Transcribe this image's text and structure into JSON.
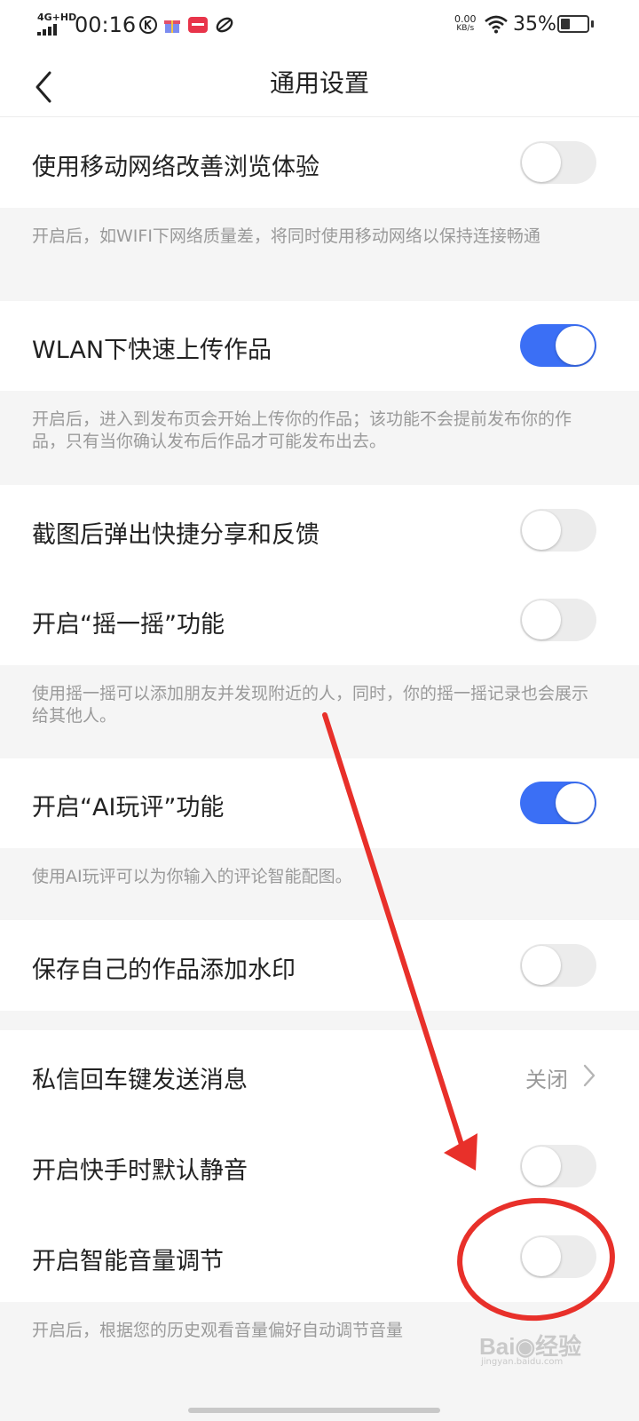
{
  "status_bar": {
    "network": "4G+HD",
    "time": "00:16",
    "speed_value": "0.00",
    "speed_unit": "KB/s",
    "battery_percent": "35%",
    "battery_level": 0.35,
    "icons": [
      "k-app-icon",
      "gift-app-icon",
      "red-app-icon",
      "leaf-app-icon",
      "wifi-icon",
      "battery-icon"
    ]
  },
  "header": {
    "title": "通用设置",
    "back_icon": "chevron-left-icon"
  },
  "settings": [
    {
      "label": "使用移动网络改善浏览体验",
      "on": false
    },
    {
      "desc": "开启后，如WIFI下网络质量差，将同时使用移动网络以保持连接畅通"
    },
    {
      "label": "WLAN下快速上传作品",
      "on": true
    },
    {
      "desc": "开启后，进入到发布页会开始上传你的作品；该功能不会提前发布你的作品，只有当你确认发布后作品才可能发布出去。"
    },
    {
      "label": "截图后弹出快捷分享和反馈",
      "on": false
    },
    {
      "label": "开启“摇一摇”功能",
      "on": false
    },
    {
      "desc": "使用摇一摇可以添加朋友并发现附近的人，同时，你的摇一摇记录也会展示给其他人。"
    },
    {
      "label": "开启“AI玩评”功能",
      "on": true
    },
    {
      "desc": "使用AI玩评可以为你输入的评论智能配图。"
    },
    {
      "label": "保存自己的作品添加水印",
      "on": false
    },
    {
      "label": "私信回车键发送消息",
      "value": "关闭"
    },
    {
      "label": "开启快手时默认静音",
      "on": false
    },
    {
      "label": "开启智能音量调节",
      "on": false
    },
    {
      "desc": "开启后，根据您的历史观看音量偏好自动调节音量"
    }
  ],
  "watermark": {
    "text_latin": "Bai",
    "text_cn": "经验",
    "url": "jingyan.baidu.com"
  },
  "colors": {
    "accent": "#3b6ff5",
    "annotation": "#e8302a",
    "desc_bg": "#f5f5f5"
  }
}
